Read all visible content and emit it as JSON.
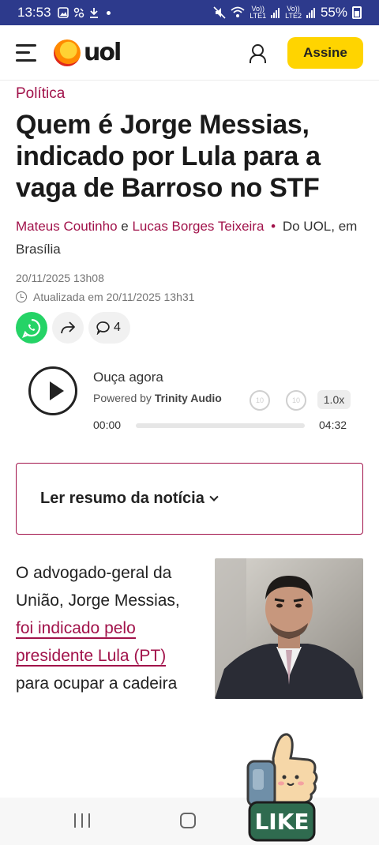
{
  "status_bar": {
    "time": "13:53",
    "battery": "55%",
    "sim1": "LTE1",
    "sim2": "LTE2",
    "volte": "Vo))"
  },
  "header": {
    "logo_text": "uol",
    "subscribe_label": "Assine"
  },
  "article": {
    "section": "Política",
    "headline": "Quem é Jorge Messias, indicado por Lula para a vaga de Barroso no STF",
    "author1": "Mateus Coutinho",
    "conjunction": "e",
    "author2": "Lucas Borges Teixeira",
    "separator": "•",
    "source": "Do UOL, em Brasília",
    "published": "20/11/2025 13h08",
    "updated": "Atualizada em 20/11/2025 13h31"
  },
  "social": {
    "comment_count": "4"
  },
  "audio": {
    "listen_label": "Ouça agora",
    "powered_label": "Powered by",
    "provider": "Trinity Audio",
    "skip_back": "10",
    "skip_forward": "10",
    "speed": "1.0x",
    "current_time": "00:00",
    "duration": "04:32",
    "progress_fraction": 0
  },
  "summary": {
    "label": "Ler resumo da notícia"
  },
  "body": {
    "text_before": "O advogado-geral da União, Jorge Messias,",
    "link": "foi indicado pelo presidente Lula (PT)",
    "text_after": "para ocupar a cadeira"
  },
  "sticker": {
    "text": "LIKE"
  },
  "colors": {
    "accent": "#a1124a",
    "subscribe": "#ffd400",
    "status_bar": "#2d3a8c",
    "whatsapp": "#25d366"
  }
}
